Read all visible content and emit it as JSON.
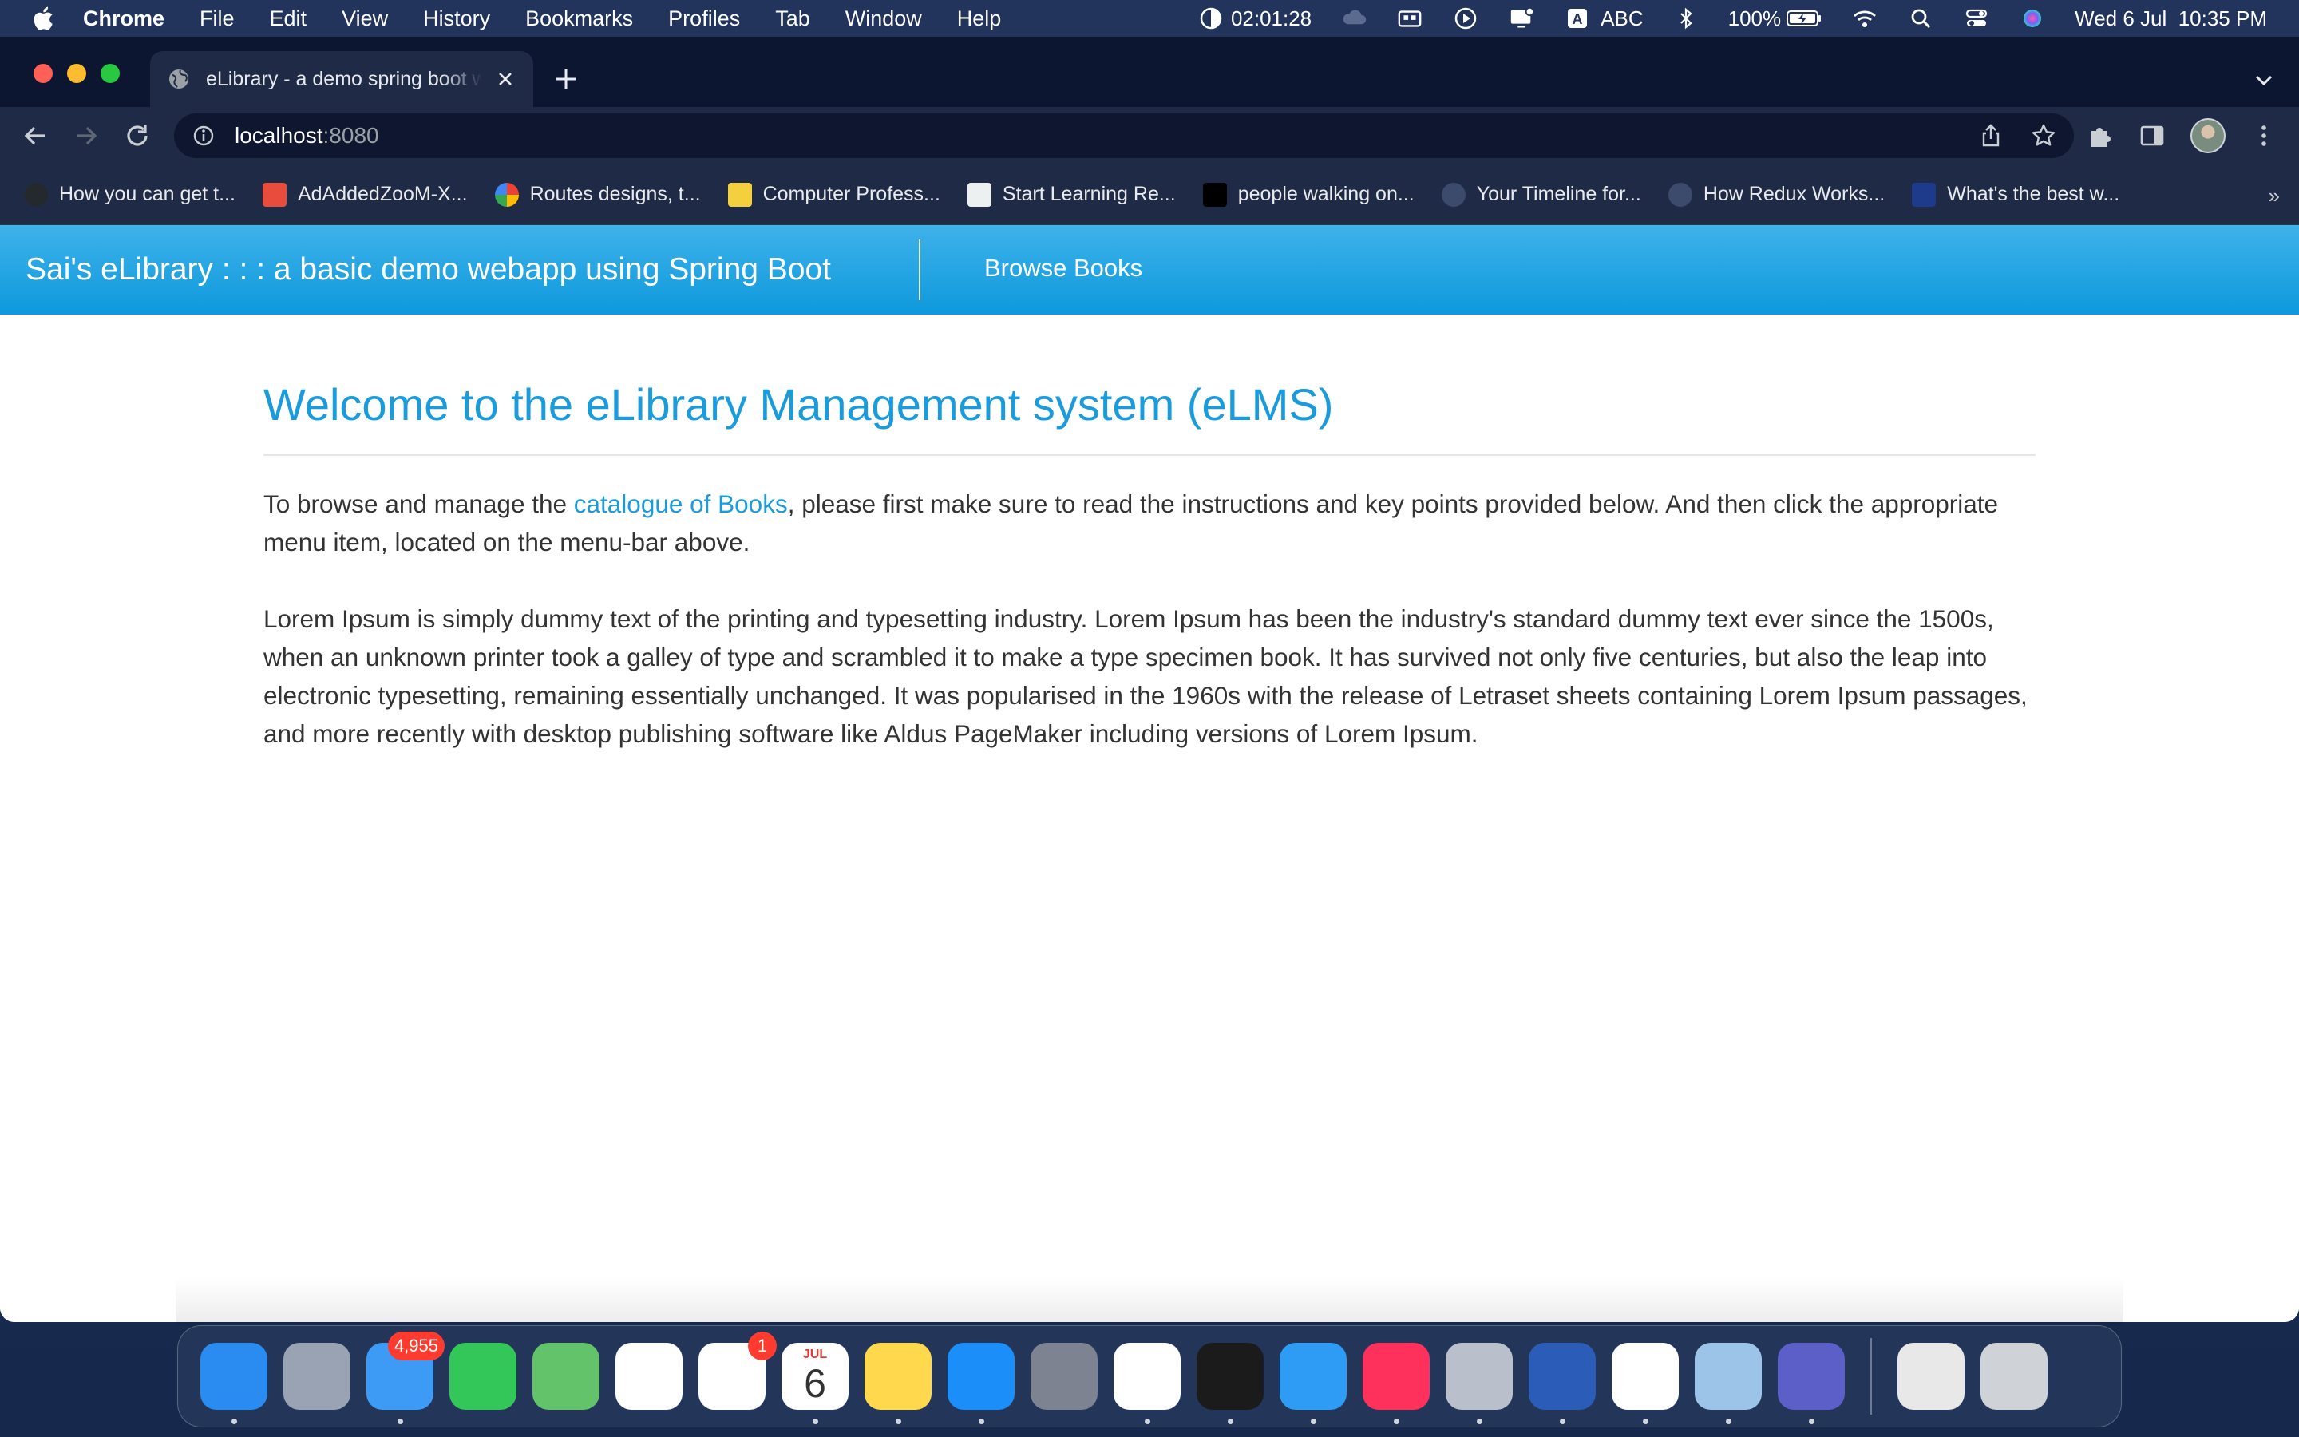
{
  "menubar": {
    "app_name": "Chrome",
    "menus": [
      "File",
      "Edit",
      "View",
      "History",
      "Bookmarks",
      "Profiles",
      "Tab",
      "Window",
      "Help"
    ],
    "timer": "02:01:28",
    "input_source": "ABC",
    "battery": "100%",
    "datetime": "Wed 6 Jul  10:35 PM"
  },
  "browser": {
    "tab_title": "eLibrary - a demo spring boot w",
    "url_host": "localhost",
    "url_port": ":8080",
    "bookmarks": [
      {
        "label": "How you can get t...",
        "icon": "github-icon",
        "color": "#24292e"
      },
      {
        "label": "AdAddedZooM-X...",
        "icon": "bookmark-favicon",
        "color": "#e74c3c"
      },
      {
        "label": "Routes designs, t...",
        "icon": "google-icon",
        "color": "#ffffff"
      },
      {
        "label": "Computer Profess...",
        "icon": "bookmark-favicon",
        "color": "#f4d03f"
      },
      {
        "label": "Start Learning Re...",
        "icon": "bookmark-favicon",
        "color": "#ecf0f1"
      },
      {
        "label": "people walking on...",
        "icon": "unsplash-icon",
        "color": "#000000"
      },
      {
        "label": "Your Timeline for...",
        "icon": "dc-icon",
        "color": "#3c4a6b"
      },
      {
        "label": "How Redux Works...",
        "icon": "dc-icon",
        "color": "#3c4a6b"
      },
      {
        "label": "What's the best w...",
        "icon": "bookmark-favicon",
        "color": "#1e3a8a"
      }
    ],
    "bookmarks_more": "»"
  },
  "site": {
    "brand": "Sai's eLibrary : : : a basic demo webapp using Spring Boot",
    "nav_link": "Browse Books",
    "heading": "Welcome to the eLibrary Management system (eLMS)",
    "intro_before": "To browse and manage the ",
    "intro_link": "catalogue of Books",
    "intro_after": ", please first make sure to read the instructions and key points provided below. And then click the appropriate menu item, located on the menu-bar above.",
    "lorem": "Lorem Ipsum is simply dummy text of the printing and typesetting industry. Lorem Ipsum has been the industry's standard dummy text ever since the 1500s, when an unknown printer took a galley of type and scrambled it to make a type specimen book. It has survived not only five centuries, but also the leap into electronic typesetting, remaining essentially unchanged. It was popularised in the 1960s with the release of Letraset sheets containing Lorem Ipsum passages, and more recently with desktop publishing software like Aldus PageMaker including versions of Lorem Ipsum."
  },
  "colors": {
    "nav_top": "#3fb2ea",
    "nav_bottom": "#0d99dc",
    "heading": "#1a9bdb",
    "link": "#1a9bdb"
  },
  "dock": {
    "items": [
      {
        "name": "finder-icon",
        "bg": "#2a8cf0",
        "running": true
      },
      {
        "name": "launchpad-icon",
        "bg": "#9aa3b3",
        "running": false
      },
      {
        "name": "mail-icon",
        "bg": "#3d9bf5",
        "running": true,
        "badge": "4,955"
      },
      {
        "name": "facetime-icon",
        "bg": "#33c759",
        "running": false
      },
      {
        "name": "maps-icon",
        "bg": "#62c36b",
        "running": false
      },
      {
        "name": "photos-icon",
        "bg": "#ffffff",
        "running": false
      },
      {
        "name": "reminders-icon",
        "bg": "#ffffff",
        "running": false,
        "badge": "1"
      },
      {
        "name": "calendar-icon",
        "bg": "#ffffff",
        "running": true,
        "month": "JUL",
        "day": "6"
      },
      {
        "name": "notes-icon",
        "bg": "#ffd84d",
        "running": true
      },
      {
        "name": "app-store-icon",
        "bg": "#1c8ef9",
        "running": true
      },
      {
        "name": "system-preferences-icon",
        "bg": "#7d8391",
        "running": false
      },
      {
        "name": "vscode-icon",
        "bg": "#ffffff",
        "running": true
      },
      {
        "name": "terminal-icon",
        "bg": "#1b1b1b",
        "running": true
      },
      {
        "name": "safari-icon",
        "bg": "#2e9cf5",
        "running": true
      },
      {
        "name": "intellij-icon",
        "bg": "#fe315d",
        "running": true
      },
      {
        "name": "settings-gear-icon",
        "bg": "#b9c0cc",
        "running": true
      },
      {
        "name": "word-icon",
        "bg": "#2b5cb8",
        "running": true
      },
      {
        "name": "chrome-icon",
        "bg": "#ffffff",
        "running": true
      },
      {
        "name": "preview-icon",
        "bg": "#9cc4e8",
        "running": true
      },
      {
        "name": "teams-icon",
        "bg": "#5b5fc7",
        "running": true
      }
    ],
    "right_items": [
      {
        "name": "documents-stack-icon",
        "bg": "#e8e8e8"
      },
      {
        "name": "trash-icon",
        "bg": "#cfd3d8"
      }
    ]
  }
}
